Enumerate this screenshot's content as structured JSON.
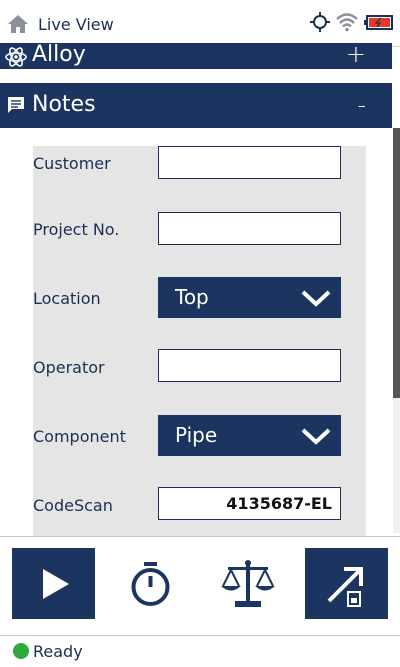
{
  "header": {
    "title": "Live View",
    "icons": [
      "home-icon",
      "crosshair-icon",
      "wifi-icon",
      "battery-icon"
    ],
    "battery_color": "#e23b2e"
  },
  "sections": {
    "alloy": {
      "label": "Alloy",
      "toggle": "+",
      "icon": "atom-icon"
    },
    "notes": {
      "label": "Notes",
      "toggle": "-",
      "icon": "notes-icon"
    }
  },
  "form": {
    "customer": {
      "label": "Customer",
      "value": ""
    },
    "project_no": {
      "label": "Project No.",
      "value": ""
    },
    "location": {
      "label": "Location",
      "value": "Top"
    },
    "operator": {
      "label": "Operator",
      "value": ""
    },
    "component": {
      "label": "Component",
      "value": "Pipe"
    },
    "codescan": {
      "label": "CodeScan",
      "value": "4135687-EL"
    }
  },
  "toolbar": {
    "buttons": [
      "play-icon",
      "timer-icon",
      "balance-icon",
      "export-icon"
    ]
  },
  "status": {
    "text": "Ready",
    "color": "#2eaa3c"
  },
  "colors": {
    "brand": "#1b3560",
    "panel": "#e5e5e5"
  }
}
